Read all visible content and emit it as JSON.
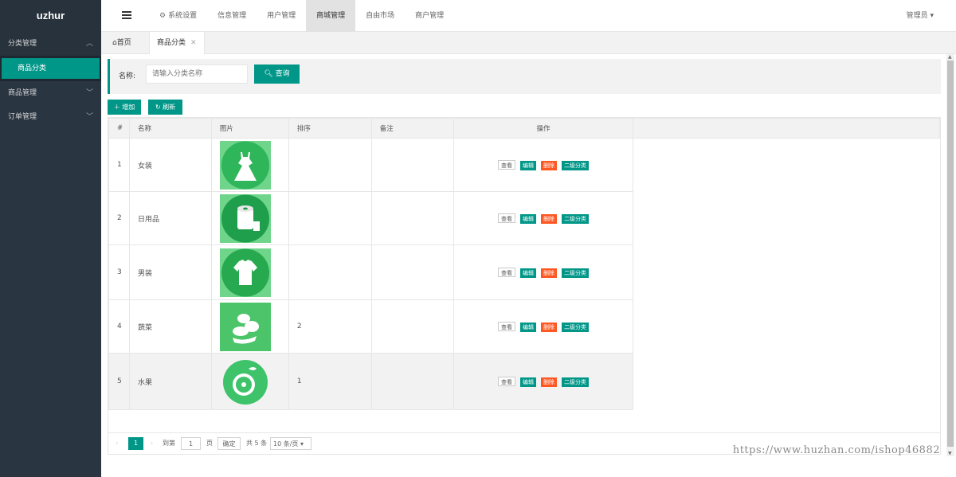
{
  "app": {
    "logo": "uzhur"
  },
  "sidebar": {
    "groups": [
      {
        "label": "分类管理",
        "open": true,
        "children": [
          {
            "label": "商品分类"
          }
        ]
      },
      {
        "label": "商品管理",
        "open": false
      },
      {
        "label": "订单管理",
        "open": false
      }
    ]
  },
  "topnav": {
    "items": [
      {
        "label": "系统设置",
        "icon": "gear-icon"
      },
      {
        "label": "信息管理"
      },
      {
        "label": "用户管理"
      },
      {
        "label": "商城管理",
        "active": true
      },
      {
        "label": "自由市场"
      },
      {
        "label": "商户管理"
      }
    ],
    "admin": "管理员"
  },
  "tabs": {
    "home": "首页",
    "active": "商品分类"
  },
  "search": {
    "label": "名称:",
    "placeholder": "请输入分类名称",
    "button": "查询"
  },
  "toolbar": {
    "add": "增加",
    "refresh": "刷新"
  },
  "table": {
    "headers": [
      "#",
      "名称",
      "图片",
      "排序",
      "备注",
      "操作"
    ],
    "rows": [
      {
        "idx": "1",
        "name": "女装",
        "image_icon": "dress-icon",
        "sort": "",
        "note": ""
      },
      {
        "idx": "2",
        "name": "日用品",
        "image_icon": "toilet-roll-icon",
        "sort": "",
        "note": ""
      },
      {
        "idx": "3",
        "name": "男装",
        "image_icon": "tshirt-icon",
        "sort": "",
        "note": ""
      },
      {
        "idx": "4",
        "name": "蔬菜",
        "image_icon": "vegetables-icon",
        "sort": "2",
        "note": ""
      },
      {
        "idx": "5",
        "name": "水果",
        "image_icon": "fruit-icon",
        "sort": "1",
        "note": ""
      }
    ],
    "actions": {
      "view": "查看",
      "edit": "编辑",
      "delete": "删除",
      "sub": "二级分类"
    }
  },
  "pager": {
    "current": "1",
    "goto_label": "到第",
    "goto_value": "1",
    "page_unit": "页",
    "confirm": "确定",
    "total": "共 5 条",
    "page_size": "10 条/页"
  },
  "watermark": "https://www.huzhan.com/ishop46882",
  "colors": {
    "accent": "#009688",
    "danger": "#ff5722",
    "sidebar": "#2a3542"
  }
}
